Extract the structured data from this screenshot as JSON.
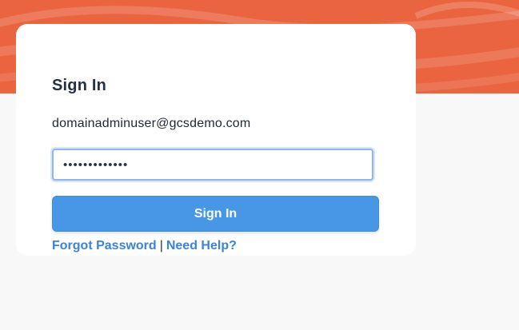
{
  "colors": {
    "banner": "#e9643f",
    "primary_button": "#4797e6",
    "link": "#3a83dc",
    "page_background": "#f8f8f8",
    "card_background": "#ffffff"
  },
  "login": {
    "title": "Sign In",
    "username": "domainadminuser@gcsdemo.com",
    "password_value": "*************",
    "sign_in_button": "Sign In",
    "forgot_password_link": "Forgot Password",
    "separator": "|",
    "need_help_link": "Need Help?"
  }
}
